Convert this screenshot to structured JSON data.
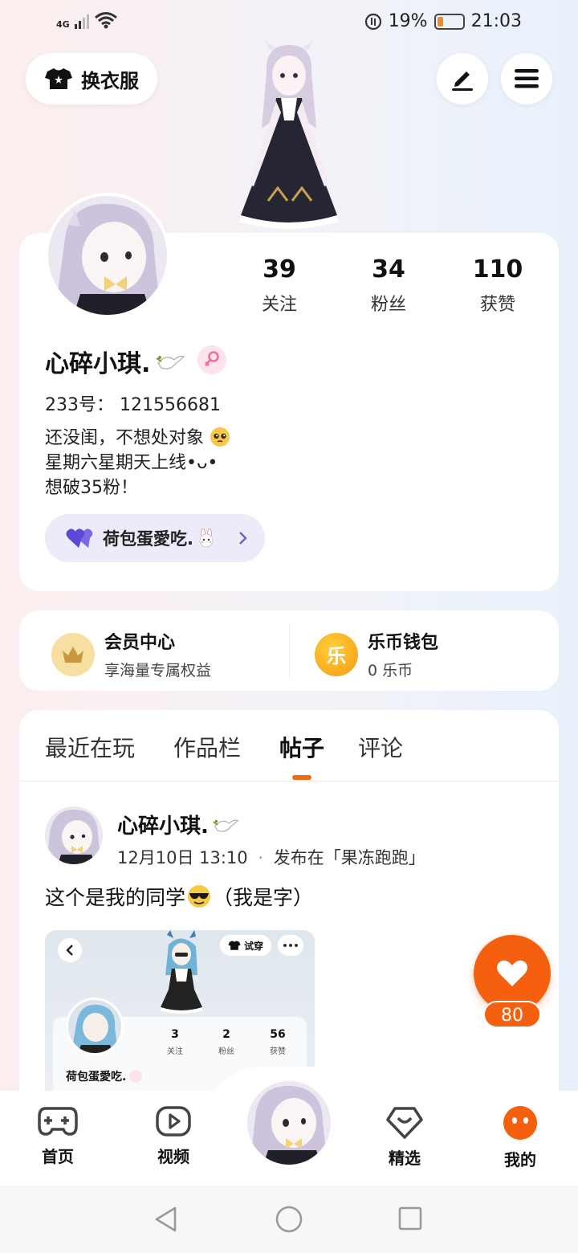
{
  "status_bar": {
    "network": "4G",
    "battery_percent": "19%",
    "time": "21:03"
  },
  "top_bar": {
    "outfit_label": "换衣服",
    "edit_icon": "pen-icon",
    "menu_icon": "menu-icon"
  },
  "profile": {
    "stats": [
      {
        "value": "39",
        "label": "关注"
      },
      {
        "value": "34",
        "label": "粉丝"
      },
      {
        "value": "110",
        "label": "获赞"
      }
    ],
    "nickname": "心碎小琪.",
    "gender_icon": "female-icon",
    "uid": "233号： 121556681",
    "bio_lines": [
      "还没闺，不想处对象",
      "星期六星期天上线•ᴗ•",
      "想破35粉！"
    ],
    "cp_name": "荷包蛋愛吃.",
    "accent_color": "#f26b16"
  },
  "member_wallet": {
    "member_title": "会员中心",
    "member_sub": "享海量专属权益",
    "wallet_title": "乐币钱包",
    "wallet_sub": "0 乐币",
    "wallet_coin_char": "乐"
  },
  "tabs": [
    "最近在玩",
    "作品栏",
    "帖子",
    "评论"
  ],
  "active_tab": "帖子",
  "post": {
    "author": "心碎小琪.",
    "date": "12月10日 13:10",
    "dot": "·",
    "published_in": "发布在「果冻跑跑」",
    "text_before": "这个是我的同学",
    "text_after": "（我是字）",
    "image": {
      "tryon_label": "试穿",
      "stats": [
        {
          "value": "3",
          "label": "关注"
        },
        {
          "value": "2",
          "label": "粉丝"
        },
        {
          "value": "56",
          "label": "获赞"
        }
      ],
      "nickname": "荷包蛋愛吃."
    }
  },
  "like": {
    "count": "80"
  },
  "bottom_nav": {
    "items": [
      {
        "label": "首页",
        "icon": "gamepad-icon"
      },
      {
        "label": "视频",
        "icon": "play-icon"
      },
      {
        "label": "精选",
        "icon": "heart-shield-icon"
      },
      {
        "label": "我的",
        "icon": "face-icon"
      }
    ]
  }
}
